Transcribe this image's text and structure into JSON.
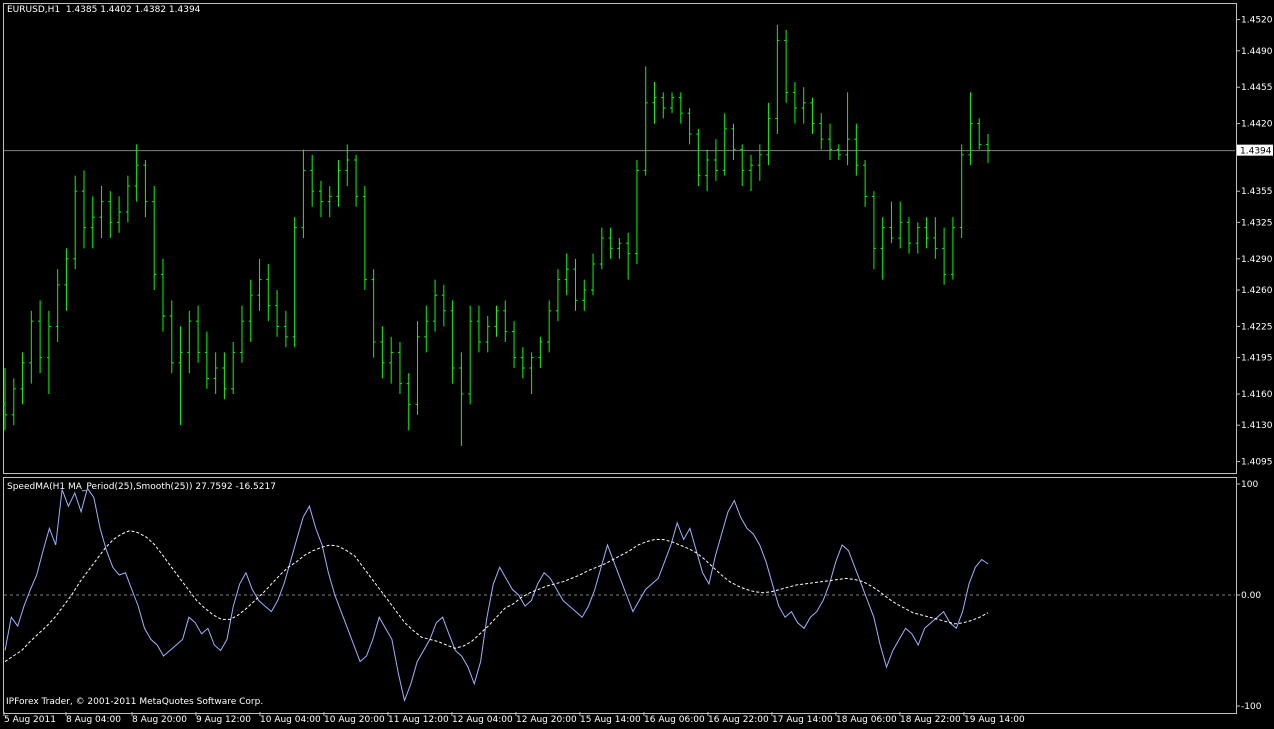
{
  "chart_header": {
    "symbol_tf": "EURUSD,H1",
    "ohlc": "1.4385 1.4402 1.4382 1.4394"
  },
  "indicator_header": "SpeedMA(H1 MA_Period(25),Smooth(25)) 27.7592 -16.5217",
  "copyright": "IPForex Trader, © 2001-2011 MetaQuotes Software Corp.",
  "colors": {
    "bars": "#00ff00",
    "speed_line": "#9db3ff",
    "signal_line": "#ffffff",
    "grid_line": "#808080"
  },
  "chart_data": [
    {
      "type": "candlestick",
      "title": "EURUSD,H1",
      "price_ticks": [
        "1.4520",
        "1.4490",
        "1.4455",
        "1.4420",
        "1.4355",
        "1.4325",
        "1.4290",
        "1.4260",
        "1.4225",
        "1.4195",
        "1.4160",
        "1.4130",
        "1.4095"
      ],
      "ylim": [
        1.4085,
        1.4535
      ],
      "current_price": "1.4394",
      "bars_ohlc": [
        [
          1.415,
          1.4185,
          1.4125,
          1.414
        ],
        [
          1.414,
          1.4175,
          1.413,
          1.4165
        ],
        [
          1.4165,
          1.42,
          1.415,
          1.419
        ],
        [
          1.419,
          1.424,
          1.417,
          1.423
        ],
        [
          1.423,
          1.425,
          1.418,
          1.4195
        ],
        [
          1.4195,
          1.424,
          1.416,
          1.4225
        ],
        [
          1.4225,
          1.428,
          1.421,
          1.4265
        ],
        [
          1.4265,
          1.43,
          1.424,
          1.429
        ],
        [
          1.429,
          1.437,
          1.428,
          1.4355
        ],
        [
          1.4355,
          1.4375,
          1.43,
          1.432
        ],
        [
          1.432,
          1.435,
          1.43,
          1.433
        ],
        [
          1.433,
          1.436,
          1.431,
          1.4345
        ],
        [
          1.4345,
          1.4355,
          1.431,
          1.4325
        ],
        [
          1.4325,
          1.435,
          1.4315,
          1.4335
        ],
        [
          1.4335,
          1.437,
          1.4325,
          1.436
        ],
        [
          1.436,
          1.44,
          1.4345,
          1.438
        ],
        [
          1.438,
          1.4385,
          1.433,
          1.4345
        ],
        [
          1.4345,
          1.436,
          1.426,
          1.4275
        ],
        [
          1.4275,
          1.429,
          1.422,
          1.4235
        ],
        [
          1.4235,
          1.425,
          1.418,
          1.419
        ],
        [
          1.419,
          1.4225,
          1.413,
          1.42
        ],
        [
          1.42,
          1.424,
          1.418,
          1.423
        ],
        [
          1.423,
          1.4245,
          1.419,
          1.42
        ],
        [
          1.42,
          1.422,
          1.4165,
          1.4175
        ],
        [
          1.4175,
          1.42,
          1.416,
          1.4185
        ],
        [
          1.4185,
          1.42,
          1.4155,
          1.4165
        ],
        [
          1.4165,
          1.421,
          1.416,
          1.42
        ],
        [
          1.42,
          1.4245,
          1.419,
          1.423
        ],
        [
          1.423,
          1.427,
          1.421,
          1.4255
        ],
        [
          1.4255,
          1.429,
          1.424,
          1.427
        ],
        [
          1.427,
          1.4285,
          1.423,
          1.4245
        ],
        [
          1.4245,
          1.426,
          1.4215,
          1.4225
        ],
        [
          1.4225,
          1.424,
          1.4205,
          1.4215
        ],
        [
          1.4215,
          1.433,
          1.4205,
          1.432
        ],
        [
          1.432,
          1.4395,
          1.431,
          1.4375
        ],
        [
          1.4375,
          1.439,
          1.434,
          1.4355
        ],
        [
          1.4355,
          1.4365,
          1.433,
          1.4345
        ],
        [
          1.4345,
          1.436,
          1.433,
          1.435
        ],
        [
          1.435,
          1.4385,
          1.434,
          1.4375
        ],
        [
          1.4375,
          1.44,
          1.436,
          1.4385
        ],
        [
          1.4385,
          1.439,
          1.434,
          1.435
        ],
        [
          1.435,
          1.436,
          1.426,
          1.427
        ],
        [
          1.427,
          1.428,
          1.4195,
          1.421
        ],
        [
          1.421,
          1.4225,
          1.4175,
          1.419
        ],
        [
          1.419,
          1.4215,
          1.417,
          1.42
        ],
        [
          1.42,
          1.421,
          1.416,
          1.417
        ],
        [
          1.417,
          1.418,
          1.4125,
          1.415
        ],
        [
          1.415,
          1.423,
          1.414,
          1.4215
        ],
        [
          1.4215,
          1.4245,
          1.42,
          1.423
        ],
        [
          1.423,
          1.427,
          1.422,
          1.4255
        ],
        [
          1.4255,
          1.4265,
          1.4225,
          1.424
        ],
        [
          1.424,
          1.425,
          1.417,
          1.4185
        ],
        [
          1.4185,
          1.42,
          1.411,
          1.416
        ],
        [
          1.416,
          1.4245,
          1.415,
          1.423
        ],
        [
          1.423,
          1.4245,
          1.42,
          1.421
        ],
        [
          1.421,
          1.4235,
          1.42,
          1.4225
        ],
        [
          1.4225,
          1.4245,
          1.4215,
          1.424
        ],
        [
          1.424,
          1.425,
          1.421,
          1.422
        ],
        [
          1.422,
          1.423,
          1.4185,
          1.4195
        ],
        [
          1.4195,
          1.4205,
          1.4175,
          1.4185
        ],
        [
          1.4185,
          1.42,
          1.416,
          1.4195
        ],
        [
          1.4195,
          1.4215,
          1.4185,
          1.421
        ],
        [
          1.421,
          1.425,
          1.42,
          1.424
        ],
        [
          1.424,
          1.428,
          1.423,
          1.427
        ],
        [
          1.427,
          1.4295,
          1.4255,
          1.428
        ],
        [
          1.428,
          1.429,
          1.424,
          1.425
        ],
        [
          1.425,
          1.427,
          1.424,
          1.426
        ],
        [
          1.426,
          1.4295,
          1.4255,
          1.4285
        ],
        [
          1.4285,
          1.432,
          1.428,
          1.431
        ],
        [
          1.431,
          1.432,
          1.429,
          1.43
        ],
        [
          1.43,
          1.431,
          1.429,
          1.4305
        ],
        [
          1.4305,
          1.4315,
          1.427,
          1.4295
        ],
        [
          1.4295,
          1.4385,
          1.4285,
          1.4375
        ],
        [
          1.4375,
          1.4475,
          1.437,
          1.444
        ],
        [
          1.444,
          1.446,
          1.442,
          1.4445
        ],
        [
          1.4445,
          1.445,
          1.4425,
          1.4435
        ],
        [
          1.4435,
          1.445,
          1.443,
          1.4445
        ],
        [
          1.4445,
          1.445,
          1.442,
          1.443
        ],
        [
          1.443,
          1.4435,
          1.44,
          1.441
        ],
        [
          1.441,
          1.4415,
          1.436,
          1.437
        ],
        [
          1.437,
          1.4395,
          1.4355,
          1.4385
        ],
        [
          1.4385,
          1.4405,
          1.4365,
          1.4375
        ],
        [
          1.4375,
          1.443,
          1.437,
          1.4415
        ],
        [
          1.4415,
          1.442,
          1.4385,
          1.4395
        ],
        [
          1.4395,
          1.44,
          1.436,
          1.4375
        ],
        [
          1.4375,
          1.439,
          1.4355,
          1.438
        ],
        [
          1.438,
          1.44,
          1.4365,
          1.439
        ],
        [
          1.439,
          1.444,
          1.438,
          1.4425
        ],
        [
          1.4425,
          1.4515,
          1.441,
          1.45
        ],
        [
          1.45,
          1.451,
          1.444,
          1.445
        ],
        [
          1.445,
          1.446,
          1.442,
          1.4435
        ],
        [
          1.4435,
          1.4455,
          1.442,
          1.444
        ],
        [
          1.444,
          1.4445,
          1.441,
          1.442
        ],
        [
          1.442,
          1.443,
          1.4395,
          1.4405
        ],
        [
          1.4405,
          1.442,
          1.4385,
          1.4395
        ],
        [
          1.4395,
          1.44,
          1.4385,
          1.439
        ],
        [
          1.439,
          1.445,
          1.438,
          1.4405
        ],
        [
          1.4405,
          1.442,
          1.437,
          1.438
        ],
        [
          1.438,
          1.4385,
          1.434,
          1.435
        ],
        [
          1.435,
          1.4355,
          1.428,
          1.43
        ],
        [
          1.43,
          1.433,
          1.427,
          1.432
        ],
        [
          1.432,
          1.4345,
          1.4305,
          1.431
        ],
        [
          1.431,
          1.4345,
          1.43,
          1.4325
        ],
        [
          1.4325,
          1.433,
          1.4295,
          1.4305
        ],
        [
          1.4305,
          1.4325,
          1.4295,
          1.432
        ],
        [
          1.432,
          1.433,
          1.43,
          1.431
        ],
        [
          1.431,
          1.433,
          1.429,
          1.43
        ],
        [
          1.43,
          1.432,
          1.4265,
          1.4275
        ],
        [
          1.4275,
          1.433,
          1.427,
          1.432
        ],
        [
          1.432,
          1.44,
          1.431,
          1.439
        ],
        [
          1.439,
          1.445,
          1.438,
          1.442
        ],
        [
          1.442,
          1.4425,
          1.4395,
          1.44
        ],
        [
          1.44,
          1.441,
          1.4382,
          1.4394
        ]
      ]
    },
    {
      "type": "line",
      "title": "SpeedMA(H1 MA_Period(25),Smooth(25))",
      "y_ticks": [
        "100",
        "0.00",
        "-100"
      ],
      "ylim": [
        -100,
        100
      ],
      "series": [
        {
          "values": [
            -50,
            -20,
            -28,
            -10,
            5,
            18,
            40,
            60,
            45,
            95,
            80,
            92,
            75,
            96,
            88,
            60,
            40,
            25,
            18,
            20,
            5,
            -10,
            -30,
            -40,
            -45,
            -55,
            -50,
            -45,
            -40,
            -20,
            -25,
            -35,
            -30,
            -45,
            -50,
            -40,
            -10,
            10,
            20,
            5,
            -5,
            -10,
            -15,
            -5,
            10,
            30,
            50,
            70,
            80,
            60,
            45,
            20,
            0,
            -15,
            -30,
            -45,
            -60,
            -55,
            -40,
            -20,
            -30,
            -40,
            -70,
            -95,
            -80,
            -60,
            -50,
            -40,
            -25,
            -20,
            -35,
            -50,
            -55,
            -65,
            -80,
            -60,
            -20,
            10,
            25,
            15,
            5,
            0,
            -10,
            -5,
            10,
            20,
            15,
            5,
            -5,
            -10,
            -15,
            -20,
            -10,
            5,
            25,
            45,
            30,
            15,
            0,
            -15,
            -5,
            5,
            10,
            15,
            30,
            45,
            65,
            50,
            60,
            40,
            20,
            10,
            35,
            55,
            75,
            85,
            70,
            60,
            55,
            45,
            30,
            10,
            -10,
            -20,
            -15,
            -25,
            -30,
            -20,
            -15,
            -5,
            10,
            30,
            45,
            40,
            25,
            10,
            -5,
            -20,
            -45,
            -65,
            -50,
            -40,
            -30,
            -35,
            -45,
            -30,
            -25,
            -20,
            -15,
            -25,
            -30,
            -15,
            10,
            25,
            32,
            28
          ]
        },
        {
          "values": [
            -60,
            -55,
            -50,
            -42,
            -35,
            -28,
            -20,
            -10,
            0,
            12,
            22,
            32,
            42,
            50,
            55,
            58,
            56,
            52,
            45,
            35,
            25,
            15,
            5,
            -5,
            -12,
            -18,
            -22,
            -22,
            -18,
            -12,
            -5,
            2,
            10,
            18,
            25,
            30,
            36,
            40,
            43,
            45,
            44,
            40,
            35,
            25,
            15,
            5,
            -5,
            -15,
            -25,
            -32,
            -38,
            -40,
            -42,
            -45,
            -48,
            -46,
            -42,
            -35,
            -28,
            -20,
            -12,
            -8,
            -2,
            2,
            5,
            8,
            10,
            12,
            15,
            18,
            22,
            25,
            28,
            32,
            36,
            40,
            45,
            48,
            50,
            50,
            48,
            45,
            42,
            38,
            32,
            25,
            18,
            12,
            8,
            5,
            3,
            2,
            3,
            5,
            7,
            9,
            10,
            11,
            12,
            13,
            14,
            15,
            14,
            12,
            8,
            3,
            -3,
            -8,
            -12,
            -16,
            -18,
            -20,
            -22,
            -24,
            -26,
            -25,
            -23,
            -20,
            -16
          ]
        }
      ]
    }
  ],
  "x_ticks": [
    "5 Aug 2011",
    "8 Aug 04:00",
    "8 Aug 20:00",
    "9 Aug 12:00",
    "10 Aug 04:00",
    "10 Aug 20:00",
    "11 Aug 12:00",
    "12 Aug 04:00",
    "12 Aug 20:00",
    "15 Aug 14:00",
    "16 Aug 06:00",
    "16 Aug 22:00",
    "17 Aug 14:00",
    "18 Aug 06:00",
    "18 Aug 22:00",
    "19 Aug 14:00"
  ]
}
